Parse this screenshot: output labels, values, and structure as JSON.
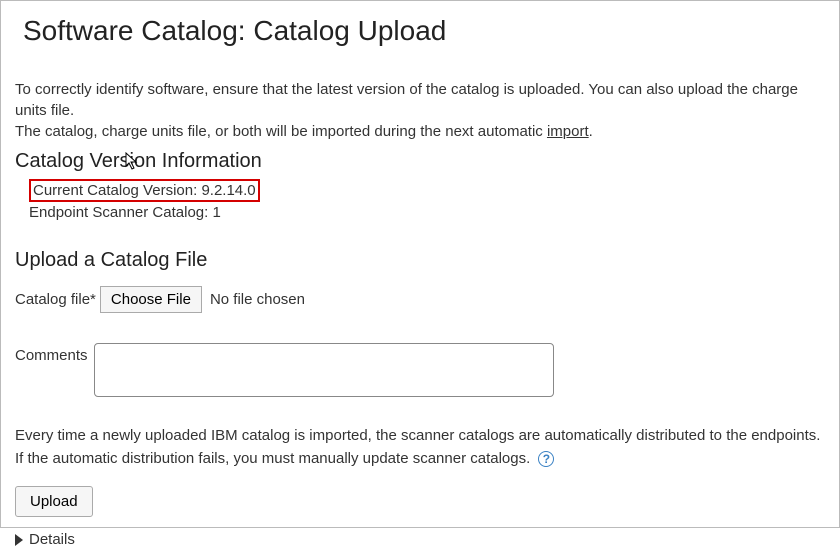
{
  "page_title": "Software Catalog: Catalog Upload",
  "intro_line1": "To correctly identify software, ensure that the latest version of the catalog is uploaded. You can also upload the charge units file.",
  "intro_line2_pre": "The catalog, charge units file, or both will be imported during the next automatic ",
  "intro_import_link": "import",
  "intro_line2_post": ".",
  "section_version_header": "Catalog Version Information",
  "current_version_label": "Current Catalog Version:",
  "current_version_value": "9.2.14.0",
  "endpoint_label": "Endpoint Scanner Catalog:",
  "endpoint_value": "1",
  "section_upload_header": "Upload a Catalog File",
  "file_label": "Catalog file*",
  "choose_file_button": "Choose File",
  "no_file_text": "No file chosen",
  "comments_label": "Comments",
  "comments_value": "",
  "note_line1": "Every time a newly uploaded IBM catalog is imported, the scanner catalogs are automatically distributed to the endpoints.",
  "note_line2": "If the automatic distribution fails, you must manually update scanner catalogs.",
  "help_icon_text": "?",
  "upload_button": "Upload",
  "details_label": "Details"
}
